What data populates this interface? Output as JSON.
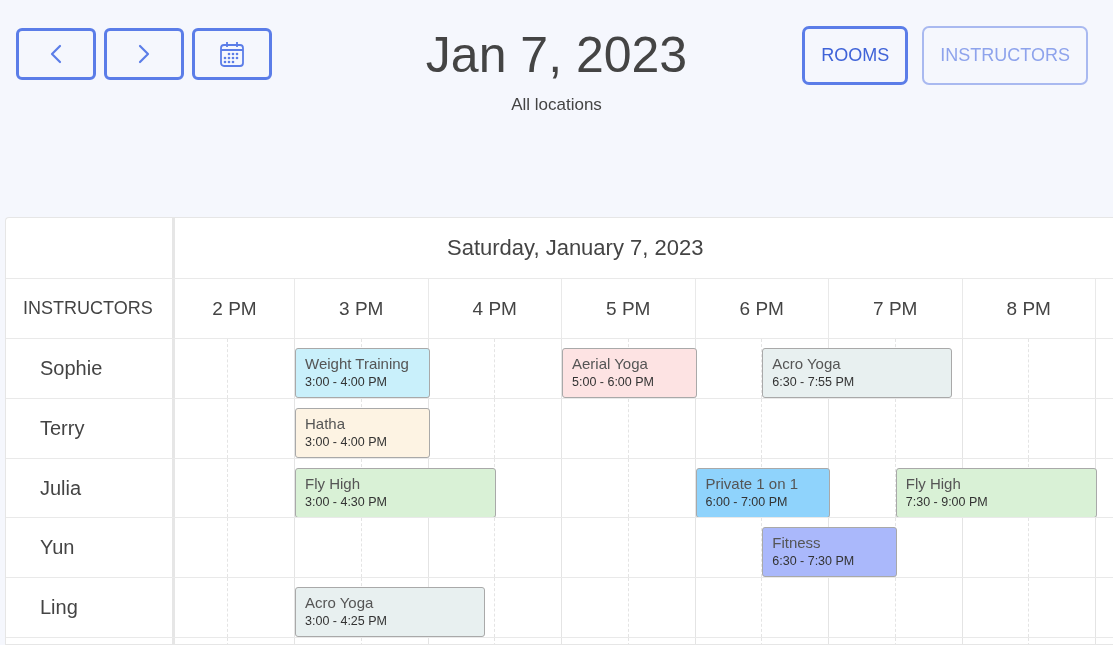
{
  "date_title": "Jan 7, 2023",
  "location": "All locations",
  "view_tabs": [
    {
      "label": "ROOMS",
      "selected": true
    },
    {
      "label": "INSTRUCTORS",
      "selected": false
    }
  ],
  "schedule": {
    "day_heading": "Saturday, January 7, 2023",
    "row_heading": "INSTRUCTORS",
    "hours": [
      "2 PM",
      "3 PM",
      "4 PM",
      "5 PM",
      "6 PM",
      "7 PM",
      "8 PM"
    ],
    "rows": [
      {
        "name": "Sophie",
        "events": [
          {
            "title": "Weight Training",
            "time": "3:00 - 4:00 PM",
            "color": "#c9f0fb"
          },
          {
            "title": "Aerial Yoga",
            "time": "5:00 - 6:00 PM",
            "color": "#fde3e3"
          },
          {
            "title": "Acro Yoga",
            "time": "6:30 - 7:55 PM",
            "color": "#e8f0f0"
          }
        ]
      },
      {
        "name": "Terry",
        "events": [
          {
            "title": "Hatha",
            "time": "3:00 - 4:00 PM",
            "color": "#fdf3e3"
          }
        ]
      },
      {
        "name": "Julia",
        "events": [
          {
            "title": "Fly High",
            "time": "3:00 - 4:30 PM",
            "color": "#d9f1d6"
          },
          {
            "title": "Private 1 on 1",
            "time": "6:00 - 7:00 PM",
            "color": "#8fd3fc"
          },
          {
            "title": "Fly High",
            "time": "7:30 - 9:00 PM",
            "color": "#d9f1d6"
          }
        ]
      },
      {
        "name": "Yun",
        "events": [
          {
            "title": "Fitness",
            "time": "6:30 - 7:30 PM",
            "color": "#aab8fb"
          }
        ]
      },
      {
        "name": "Ling",
        "events": [
          {
            "title": "Acro Yoga",
            "time": "3:00 - 4:25 PM",
            "color": "#e8f0f0"
          }
        ]
      }
    ]
  }
}
